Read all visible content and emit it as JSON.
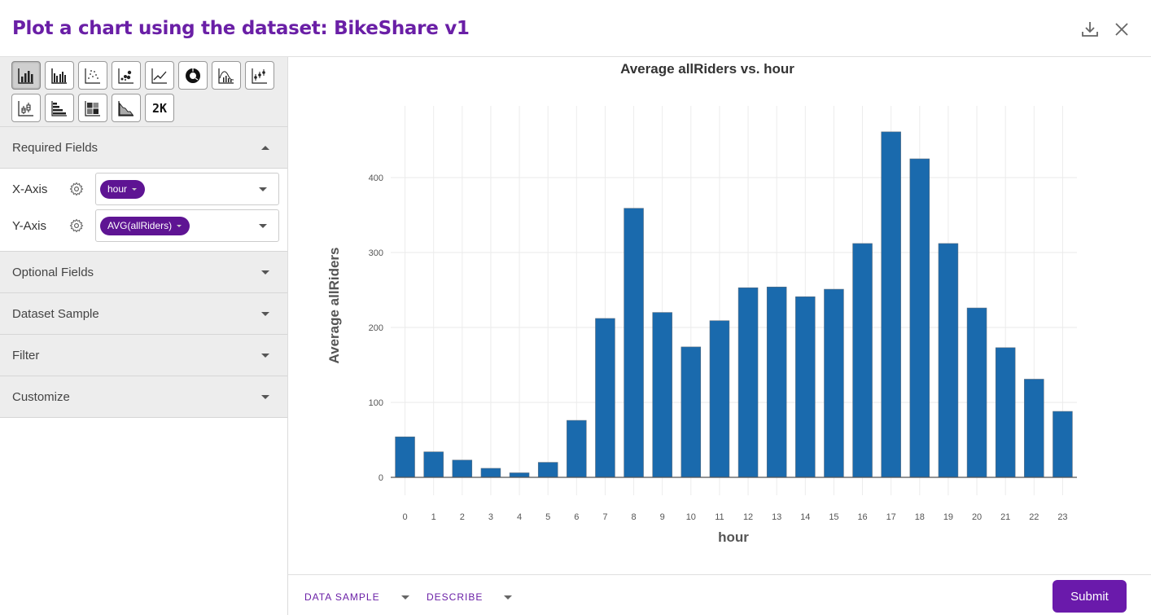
{
  "header": {
    "title": "Plot a chart using the dataset: BikeShare v1",
    "icons": [
      "download-icon",
      "close-icon"
    ]
  },
  "toolbar": {
    "chart_types": [
      {
        "name": "bar-chart",
        "active": true
      },
      {
        "name": "grouped-bar-chart",
        "active": false
      },
      {
        "name": "scatter-chart",
        "active": false
      },
      {
        "name": "bubble-chart",
        "active": false
      },
      {
        "name": "line-chart",
        "active": false
      },
      {
        "name": "donut-chart",
        "active": false
      },
      {
        "name": "histogram-density-chart",
        "active": false
      },
      {
        "name": "error-bar-chart",
        "active": false
      },
      {
        "name": "box-plot-chart",
        "active": false
      },
      {
        "name": "horizontal-bar-chart",
        "active": false
      },
      {
        "name": "heatmap-chart",
        "active": false
      },
      {
        "name": "area-chart",
        "active": false
      },
      {
        "name": "big-number-chart",
        "active": false,
        "label": "2K"
      }
    ]
  },
  "sidebar": {
    "required_fields_label": "Required Fields",
    "x_axis_label": "X-Axis",
    "x_axis_value": "hour",
    "y_axis_label": "Y-Axis",
    "y_axis_value": "AVG(allRiders)",
    "sections": [
      "Optional Fields",
      "Dataset Sample",
      "Filter",
      "Customize"
    ]
  },
  "footer": {
    "data_sample_label": "DATA SAMPLE",
    "describe_label": "DESCRIBE",
    "submit_label": "Submit"
  },
  "colors": {
    "accent": "#6a1fa6",
    "bar": "#1a6aad",
    "chip": "#5e1493"
  },
  "chart_data": {
    "type": "bar",
    "title": "Average allRiders vs. hour",
    "xlabel": "hour",
    "ylabel": "Average allRiders",
    "categories": [
      "0",
      "1",
      "2",
      "3",
      "4",
      "5",
      "6",
      "7",
      "8",
      "9",
      "10",
      "11",
      "12",
      "13",
      "14",
      "15",
      "16",
      "17",
      "18",
      "19",
      "20",
      "21",
      "22",
      "23"
    ],
    "values": [
      54,
      34,
      23,
      12,
      6,
      20,
      76,
      212,
      359,
      220,
      174,
      209,
      253,
      254,
      241,
      251,
      312,
      461,
      425,
      312,
      226,
      173,
      131,
      88
    ],
    "yticks": [
      0,
      100,
      200,
      300,
      400
    ],
    "ylim": [
      0,
      495
    ],
    "grid": true,
    "legend": "none"
  }
}
